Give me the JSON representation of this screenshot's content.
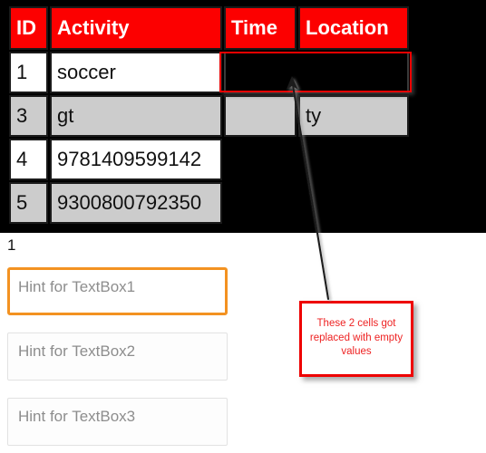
{
  "table": {
    "columns": [
      "ID",
      "Activity",
      "Time",
      "Location"
    ],
    "rows": [
      {
        "id": "1",
        "activity": "soccer",
        "time": "",
        "location": "",
        "emptied": true
      },
      {
        "id": "3",
        "activity": "gt",
        "time": "",
        "location": "ty",
        "emptied": false
      },
      {
        "id": "4",
        "activity": "9781409599142",
        "time": null,
        "location": null,
        "emptied": false
      },
      {
        "id": "5",
        "activity": "9300800792350",
        "time": null,
        "location": null,
        "emptied": false
      }
    ]
  },
  "counter": {
    "value": "1"
  },
  "form": {
    "fields": [
      {
        "name": "textbox1",
        "value": "",
        "placeholder": "Hint for TextBox1",
        "focused": true
      },
      {
        "name": "textbox2",
        "value": "",
        "placeholder": "Hint for TextBox2",
        "focused": false
      },
      {
        "name": "textbox3",
        "value": "",
        "placeholder": "Hint for TextBox3",
        "focused": false
      }
    ]
  },
  "annotation": {
    "text": "These 2 cells got replaced with empty values",
    "border_color": "#ee0000",
    "text_color": "#ee2222"
  },
  "colors": {
    "header_red": "#fc0000",
    "row_odd": "#ffffff",
    "row_even": "#cccccc",
    "app_background": "#000000",
    "focus_orange": "#f39221",
    "hint_gray": "#8d8d8d"
  }
}
